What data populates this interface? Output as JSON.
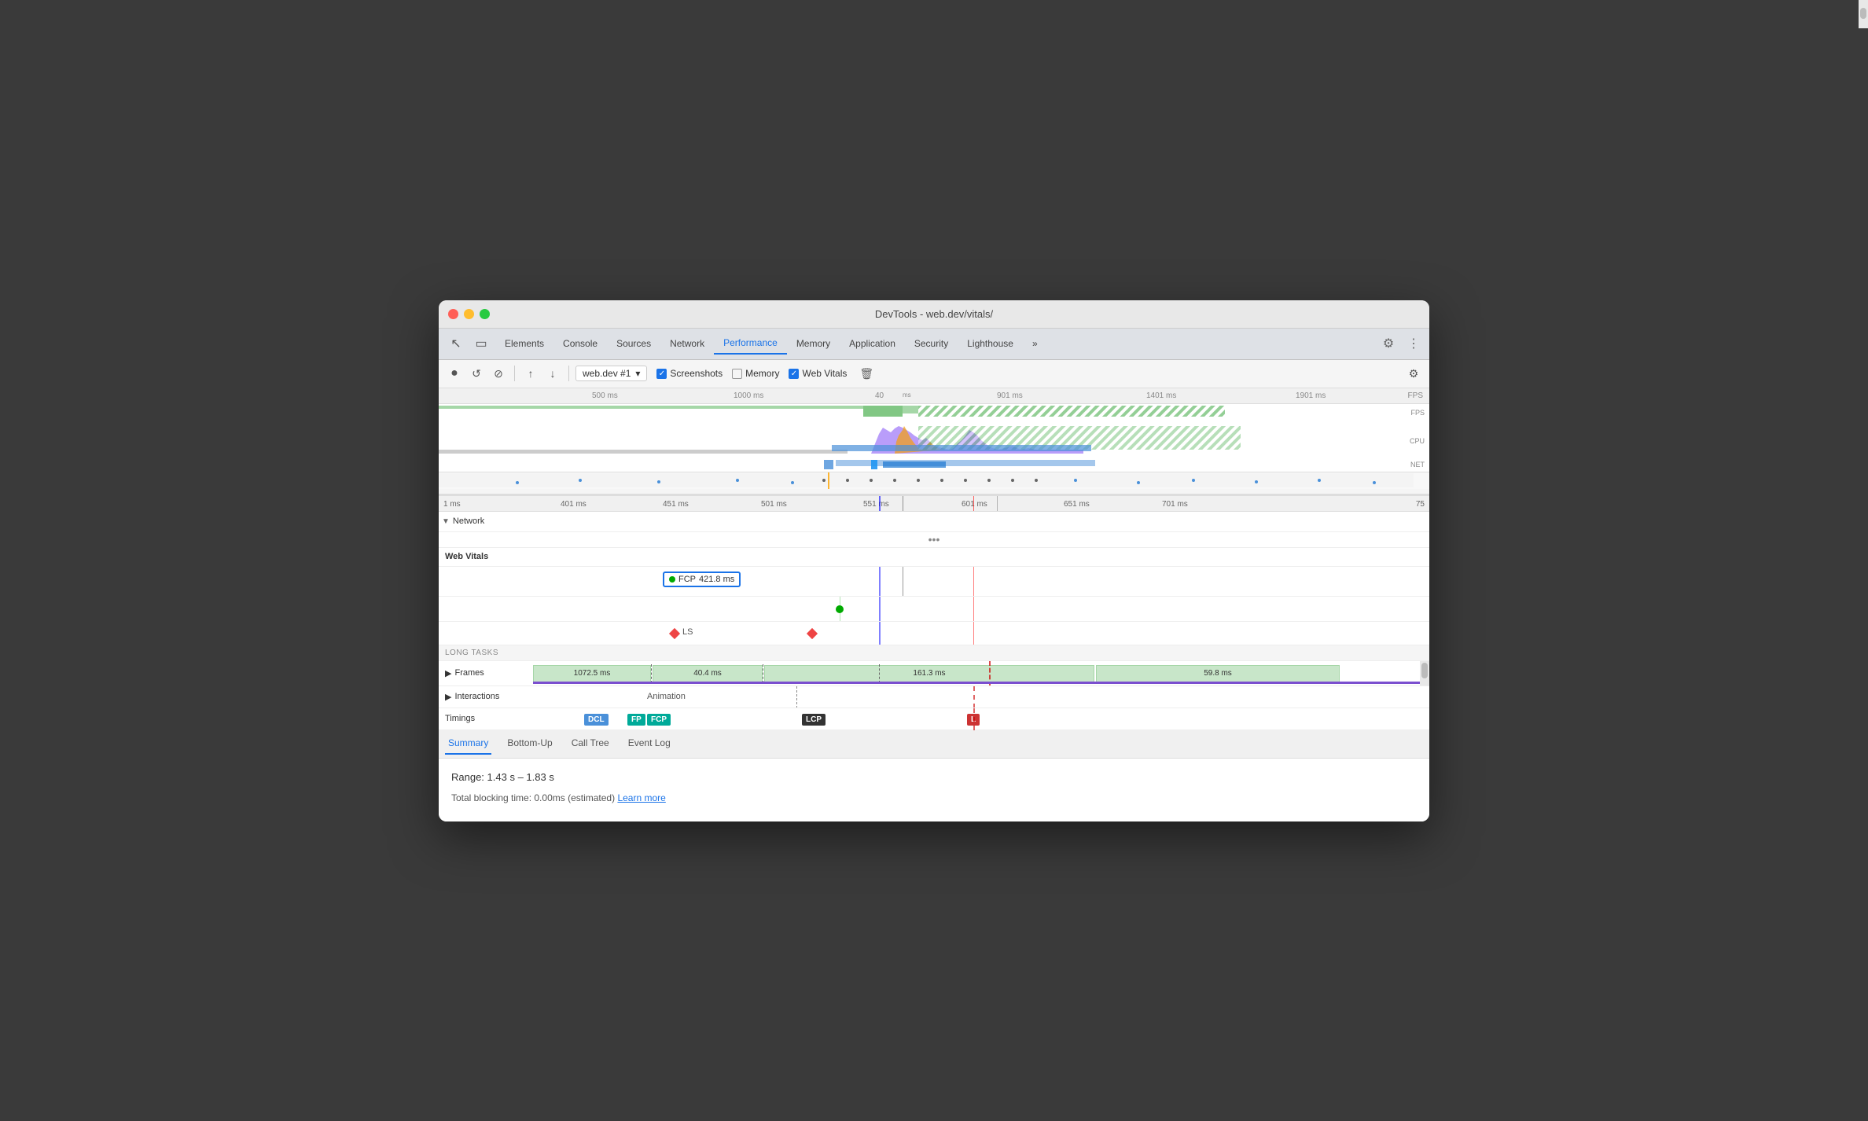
{
  "window": {
    "title": "DevTools - web.dev/vitals/"
  },
  "tabs": {
    "items": [
      {
        "label": "Elements"
      },
      {
        "label": "Console"
      },
      {
        "label": "Sources"
      },
      {
        "label": "Network"
      },
      {
        "label": "Performance"
      },
      {
        "label": "Memory"
      },
      {
        "label": "Application"
      },
      {
        "label": "Security"
      },
      {
        "label": "Lighthouse"
      }
    ],
    "active": "Performance",
    "more_label": "»"
  },
  "toolbar": {
    "record_label": "●",
    "reload_label": "↺",
    "clear_label": "⊘",
    "upload_label": "↑",
    "download_label": "↓",
    "source_label": "web.dev #1",
    "screenshots_label": "Screenshots",
    "memory_label": "Memory",
    "web_vitals_label": "Web Vitals",
    "trash_label": "🗑",
    "settings_label": "⚙"
  },
  "overview": {
    "ruler_ticks": [
      "500 ms",
      "1000 ms",
      "40",
      "ms",
      "901 ms",
      "1401 ms",
      "1901 ms"
    ],
    "labels": [
      "FPS",
      "CPU",
      "NET"
    ]
  },
  "detail": {
    "ruler_ticks": [
      "1 ms",
      "401 ms",
      "451 ms",
      "501 ms",
      "551 ms",
      "601 ms",
      "651 ms",
      "701 ms",
      "75"
    ],
    "network_label": "Network"
  },
  "web_vitals": {
    "header": "Web Vitals",
    "fcp_label": "FCP",
    "fcp_value": "421.8 ms",
    "ls_label": "LS",
    "long_tasks_label": "LONG TASKS"
  },
  "frames": {
    "label": "Frames",
    "expand_icon": "▶",
    "blocks": [
      {
        "label": "1072.5 ms",
        "color": "#c8e6c9"
      },
      {
        "label": "40.4 ms",
        "color": "#c8e6c9"
      },
      {
        "label": "161.3 ms",
        "color": "#c8e6c9"
      },
      {
        "label": "59.8 ms",
        "color": "#c8e6c9"
      }
    ]
  },
  "interactions": {
    "label": "Interactions",
    "expand_icon": "▶",
    "animation_label": "Animation"
  },
  "timings": {
    "label": "Timings",
    "items": [
      {
        "label": "DCL",
        "class": "badge-dcl"
      },
      {
        "label": "FP",
        "class": "badge-fp"
      },
      {
        "label": "FCP",
        "class": "badge-fcp"
      },
      {
        "label": "LCP",
        "class": "badge-lcp"
      },
      {
        "label": "L",
        "class": "badge-l"
      }
    ]
  },
  "bottom_panel": {
    "tabs": [
      {
        "label": "Summary",
        "active": true
      },
      {
        "label": "Bottom-Up"
      },
      {
        "label": "Call Tree"
      },
      {
        "label": "Event Log"
      }
    ],
    "range_label": "Range:",
    "range_value": "1.43 s – 1.83 s",
    "blocking_label": "Total blocking time: 0.00ms (estimated)",
    "learn_more_label": "Learn more"
  }
}
